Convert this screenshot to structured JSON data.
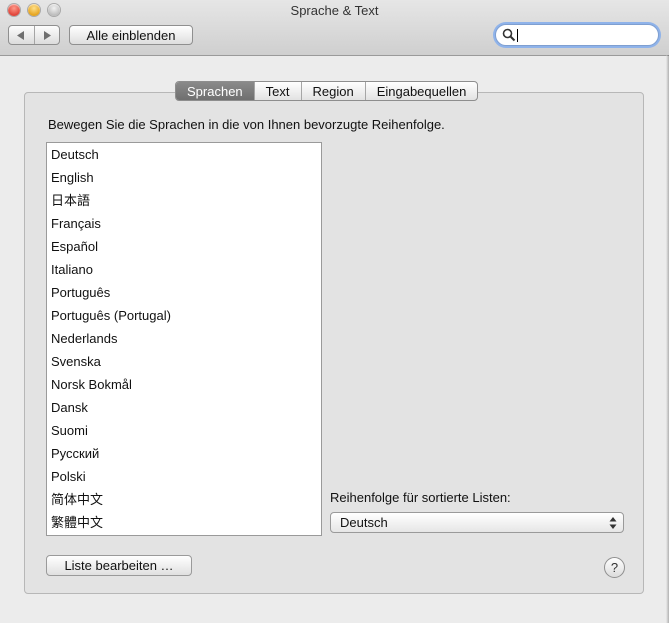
{
  "window": {
    "title": "Sprache & Text"
  },
  "toolbar": {
    "back_icon": "triangle-left",
    "forward_icon": "triangle-right",
    "show_all_label": "Alle einblenden",
    "search_value": ""
  },
  "tabs": [
    {
      "label": "Sprachen",
      "selected": true
    },
    {
      "label": "Text",
      "selected": false
    },
    {
      "label": "Region",
      "selected": false
    },
    {
      "label": "Eingabequellen",
      "selected": false
    }
  ],
  "main": {
    "instructions": "Bewegen Sie die Sprachen in die von Ihnen bevorzugte Reihenfolge.",
    "languages": [
      "Deutsch",
      "English",
      "日本語",
      "Français",
      "Español",
      "Italiano",
      "Português",
      "Português (Portugal)",
      "Nederlands",
      "Svenska",
      "Norsk Bokmål",
      "Dansk",
      "Suomi",
      "Русский",
      "Polski",
      "简体中文",
      "繁體中文"
    ],
    "sort_label": "Reihenfolge für sortierte Listen:",
    "sort_value": "Deutsch",
    "edit_list_label": "Liste bearbeiten …",
    "help_label": "?"
  },
  "colors": {
    "selected_tab": "#7d7d7d",
    "close": "#e0443a",
    "minimize": "#e5a41f",
    "search_focus": "#8fb3ea"
  }
}
